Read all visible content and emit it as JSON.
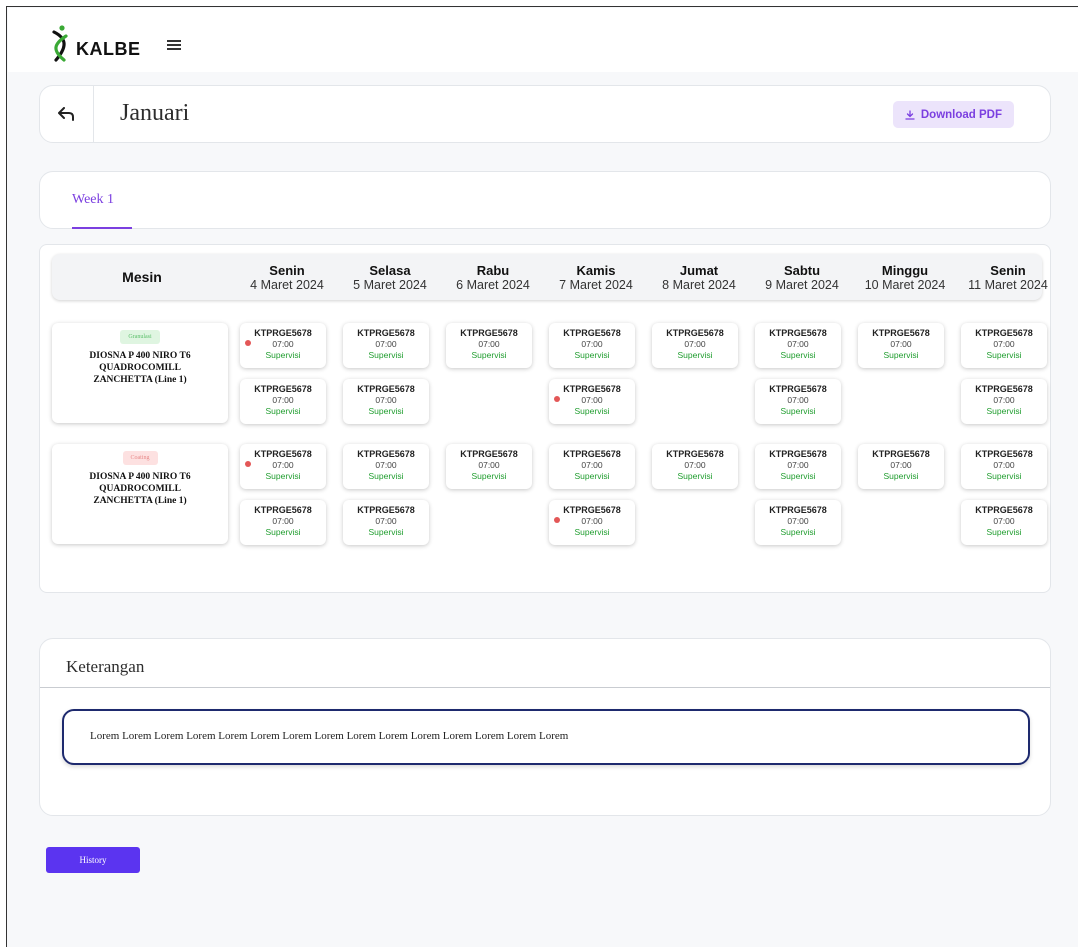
{
  "brand": {
    "name": "KALBE"
  },
  "header": {
    "title": "Januari",
    "download_label": "Download PDF"
  },
  "tabs": [
    {
      "label": "Week 1",
      "active": true
    }
  ],
  "schedule": {
    "mesin_header": "Mesin",
    "days": [
      {
        "name": "Senin",
        "date": "4 Maret 2024"
      },
      {
        "name": "Selasa",
        "date": "5 Maret 2024"
      },
      {
        "name": "Rabu",
        "date": "6 Maret 2024"
      },
      {
        "name": "Kamis",
        "date": "7 Maret 2024"
      },
      {
        "name": "Jumat",
        "date": "8 Maret 2024"
      },
      {
        "name": "Sabtu",
        "date": "9 Maret 2024"
      },
      {
        "name": "Minggu",
        "date": "10 Maret 2024"
      },
      {
        "name": "Senin",
        "date": "11 Maret 2024"
      }
    ],
    "machines": [
      {
        "badge": "Granulasi",
        "badge_bg": "#dff5e1",
        "badge_color": "#5bbf6a",
        "name": "DIOSNA P 400 NIRO T6 QUADROCOMILL ZANCHETTA (Line 1)"
      },
      {
        "badge": "Coating",
        "badge_bg": "#fde1e1",
        "badge_color": "#e88a8a",
        "name": "DIOSNA P 400 NIRO T6 QUADROCOMILL ZANCHETTA (Line 1)"
      }
    ],
    "entries": [
      {
        "machine": 0,
        "slot": 0,
        "day": 0,
        "code": "KTPRGE5678",
        "time": "07:00",
        "role": "Supervisi",
        "alert": true
      },
      {
        "machine": 0,
        "slot": 0,
        "day": 1,
        "code": "KTPRGE5678",
        "time": "07:00",
        "role": "Supervisi",
        "alert": false
      },
      {
        "machine": 0,
        "slot": 0,
        "day": 2,
        "code": "KTPRGE5678",
        "time": "07:00",
        "role": "Supervisi",
        "alert": false
      },
      {
        "machine": 0,
        "slot": 0,
        "day": 3,
        "code": "KTPRGE5678",
        "time": "07:00",
        "role": "Supervisi",
        "alert": false
      },
      {
        "machine": 0,
        "slot": 0,
        "day": 4,
        "code": "KTPRGE5678",
        "time": "07:00",
        "role": "Supervisi",
        "alert": false
      },
      {
        "machine": 0,
        "slot": 0,
        "day": 5,
        "code": "KTPRGE5678",
        "time": "07:00",
        "role": "Supervisi",
        "alert": false
      },
      {
        "machine": 0,
        "slot": 0,
        "day": 6,
        "code": "KTPRGE5678",
        "time": "07:00",
        "role": "Supervisi",
        "alert": false
      },
      {
        "machine": 0,
        "slot": 0,
        "day": 7,
        "code": "KTPRGE5678",
        "time": "07:00",
        "role": "Supervisi",
        "alert": false
      },
      {
        "machine": 0,
        "slot": 1,
        "day": 0,
        "code": "KTPRGE5678",
        "time": "07:00",
        "role": "Supervisi",
        "alert": false
      },
      {
        "machine": 0,
        "slot": 1,
        "day": 1,
        "code": "KTPRGE5678",
        "time": "07:00",
        "role": "Supervisi",
        "alert": false
      },
      {
        "machine": 0,
        "slot": 1,
        "day": 3,
        "code": "KTPRGE5678",
        "time": "07:00",
        "role": "Supervisi",
        "alert": true
      },
      {
        "machine": 0,
        "slot": 1,
        "day": 5,
        "code": "KTPRGE5678",
        "time": "07:00",
        "role": "Supervisi",
        "alert": false
      },
      {
        "machine": 0,
        "slot": 1,
        "day": 7,
        "code": "KTPRGE5678",
        "time": "07:00",
        "role": "Supervisi",
        "alert": false
      },
      {
        "machine": 1,
        "slot": 0,
        "day": 0,
        "code": "KTPRGE5678",
        "time": "07:00",
        "role": "Supervisi",
        "alert": true
      },
      {
        "machine": 1,
        "slot": 0,
        "day": 1,
        "code": "KTPRGE5678",
        "time": "07:00",
        "role": "Supervisi",
        "alert": false
      },
      {
        "machine": 1,
        "slot": 0,
        "day": 2,
        "code": "KTPRGE5678",
        "time": "07:00",
        "role": "Supervisi",
        "alert": false
      },
      {
        "machine": 1,
        "slot": 0,
        "day": 3,
        "code": "KTPRGE5678",
        "time": "07:00",
        "role": "Supervisi",
        "alert": false
      },
      {
        "machine": 1,
        "slot": 0,
        "day": 4,
        "code": "KTPRGE5678",
        "time": "07:00",
        "role": "Supervisi",
        "alert": false
      },
      {
        "machine": 1,
        "slot": 0,
        "day": 5,
        "code": "KTPRGE5678",
        "time": "07:00",
        "role": "Supervisi",
        "alert": false
      },
      {
        "machine": 1,
        "slot": 0,
        "day": 6,
        "code": "KTPRGE5678",
        "time": "07:00",
        "role": "Supervisi",
        "alert": false
      },
      {
        "machine": 1,
        "slot": 0,
        "day": 7,
        "code": "KTPRGE5678",
        "time": "07:00",
        "role": "Supervisi",
        "alert": false
      },
      {
        "machine": 1,
        "slot": 1,
        "day": 0,
        "code": "KTPRGE5678",
        "time": "07:00",
        "role": "Supervisi",
        "alert": false
      },
      {
        "machine": 1,
        "slot": 1,
        "day": 1,
        "code": "KTPRGE5678",
        "time": "07:00",
        "role": "Supervisi",
        "alert": false
      },
      {
        "machine": 1,
        "slot": 1,
        "day": 3,
        "code": "KTPRGE5678",
        "time": "07:00",
        "role": "Supervisi",
        "alert": true
      },
      {
        "machine": 1,
        "slot": 1,
        "day": 5,
        "code": "KTPRGE5678",
        "time": "07:00",
        "role": "Supervisi",
        "alert": false
      },
      {
        "machine": 1,
        "slot": 1,
        "day": 7,
        "code": "KTPRGE5678",
        "time": "07:00",
        "role": "Supervisi",
        "alert": false
      }
    ]
  },
  "keterangan": {
    "title": "Keterangan",
    "text": "Lorem Lorem Lorem Lorem Lorem Lorem Lorem Lorem Lorem Lorem Lorem Lorem Lorem Lorem Lorem"
  },
  "footer": {
    "history_label": "History"
  },
  "colors": {
    "accent": "#7b3fe0",
    "primary_button": "#5b34f0",
    "success": "#1f9d2e",
    "alert": "#e35757",
    "border_dark": "#1e2a6e"
  },
  "icons": {
    "back": "back-arrow-icon",
    "download": "download-icon",
    "menu": "hamburger-icon",
    "alert": "alert-icon"
  }
}
